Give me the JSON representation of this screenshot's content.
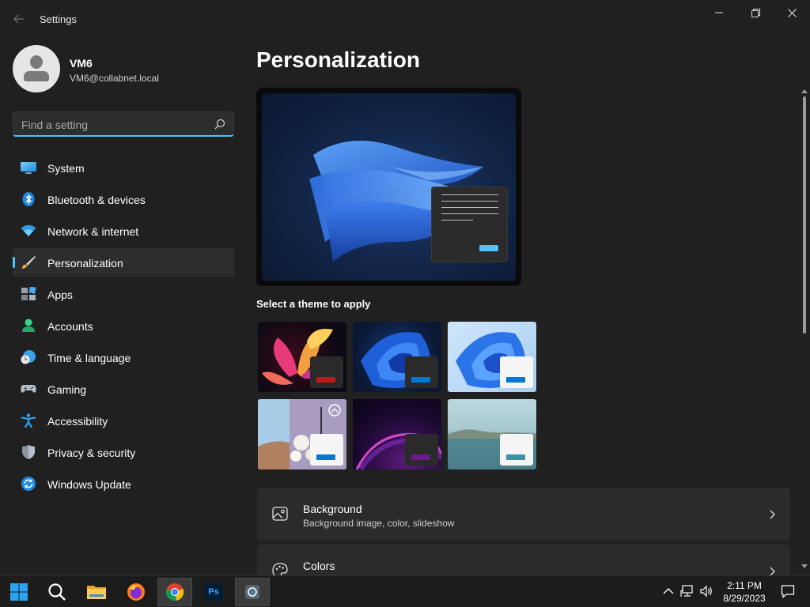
{
  "window": {
    "title": "Settings",
    "back_icon": "back-arrow-icon",
    "controls": [
      "minimize-icon",
      "restore-icon",
      "close-icon"
    ]
  },
  "user": {
    "name": "VM6",
    "email": "VM6@collabnet.local"
  },
  "search": {
    "placeholder": "Find a setting",
    "value": ""
  },
  "nav": {
    "items": [
      {
        "label": "System",
        "icon": "system-monitor-icon",
        "active": false
      },
      {
        "label": "Bluetooth & devices",
        "icon": "bluetooth-icon",
        "active": false
      },
      {
        "label": "Network & internet",
        "icon": "wifi-icon",
        "active": false
      },
      {
        "label": "Personalization",
        "icon": "paintbrush-icon",
        "active": true
      },
      {
        "label": "Apps",
        "icon": "apps-icon",
        "active": false
      },
      {
        "label": "Accounts",
        "icon": "person-icon",
        "active": false
      },
      {
        "label": "Time & language",
        "icon": "globe-clock-icon",
        "active": false
      },
      {
        "label": "Gaming",
        "icon": "gamepad-icon",
        "active": false
      },
      {
        "label": "Accessibility",
        "icon": "accessibility-icon",
        "active": false
      },
      {
        "label": "Privacy & security",
        "icon": "shield-icon",
        "active": false
      },
      {
        "label": "Windows Update",
        "icon": "update-icon",
        "active": false
      }
    ]
  },
  "main": {
    "title": "Personalization",
    "themes_heading": "Select a theme to apply",
    "themes": [
      {
        "name": "theme-glow",
        "accent": "#c4141c"
      },
      {
        "name": "theme-dark-bloom",
        "accent": "#0078d4"
      },
      {
        "name": "theme-light-bloom",
        "accent": "#0078d4"
      },
      {
        "name": "theme-captured-motion",
        "accent": "#0078d4"
      },
      {
        "name": "theme-sunrise",
        "accent": "#6b1a8a"
      },
      {
        "name": "theme-flow",
        "accent": "#3f8fa8"
      }
    ],
    "cards": [
      {
        "title": "Background",
        "subtitle": "Background image, color, slideshow",
        "icon": "image-icon"
      },
      {
        "title": "Colors",
        "subtitle": "",
        "icon": "palette-icon"
      }
    ]
  },
  "taskbar": {
    "apps": [
      "windows-start-icon",
      "search-icon",
      "file-explorer-icon",
      "firefox-icon",
      "chrome-icon",
      "photoshop-icon",
      "settings-icon"
    ],
    "photoshop_label": "Ps",
    "time": "2:11 PM",
    "date": "8/29/2023"
  },
  "colors": {
    "accent": "#4cc2ff",
    "background": "#202020",
    "card": "#2b2b2b"
  }
}
